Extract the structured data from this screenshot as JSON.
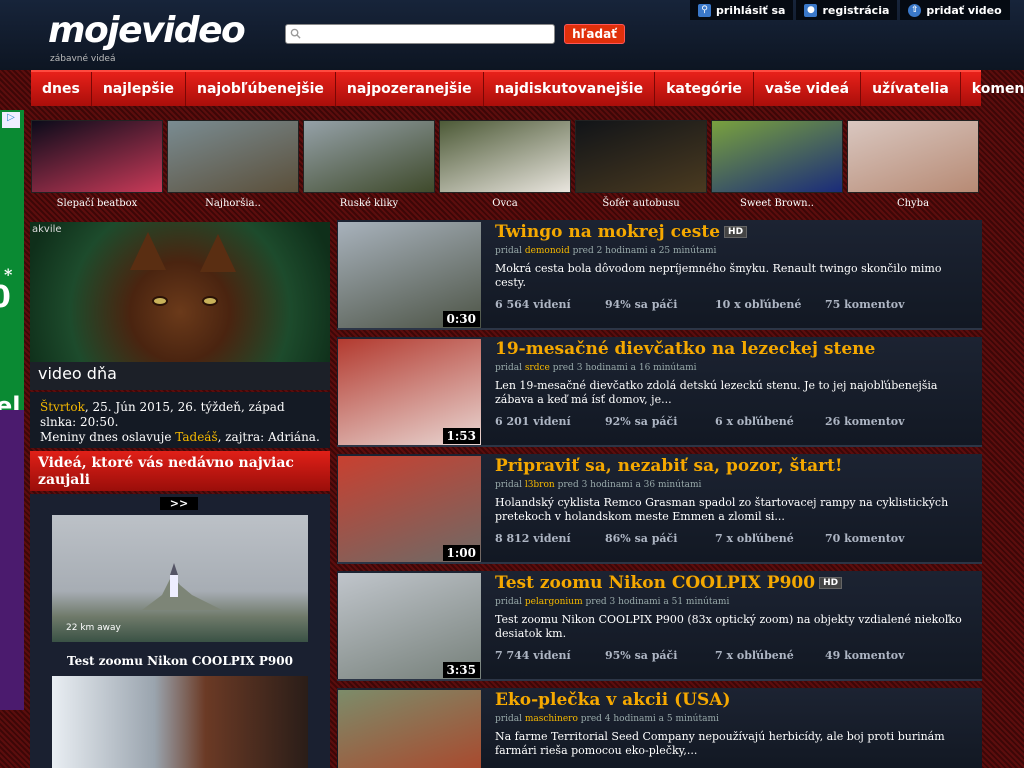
{
  "header": {
    "logo": "mojevideo",
    "logo_sub": "zábavné videá",
    "search_placeholder": "",
    "search_button": "hľadať",
    "top_links": [
      {
        "label": "prihlásiť sa",
        "icon": "search-icon"
      },
      {
        "label": "registrácia",
        "icon": "user-icon"
      },
      {
        "label": "pridať video",
        "icon": "upload-icon"
      }
    ]
  },
  "nav": [
    "dnes",
    "najlepšie",
    "najobľúbenejšie",
    "najpozeranejšie",
    "najdiskutovanejšie",
    "kategórie",
    "vaše videá",
    "užívatelia",
    "komentáre"
  ],
  "ad": {
    "star": "*",
    "big": "0",
    "big2": "el"
  },
  "strip": [
    {
      "label": "Slepačí beatbox",
      "c1": "#0b0b1a",
      "c2": "#c83a58"
    },
    {
      "label": "Najhoršia..",
      "c1": "#7a8c92",
      "c2": "#5b4f3a"
    },
    {
      "label": "Ruské kliky",
      "c1": "#95a1a8",
      "c2": "#3f4a2b"
    },
    {
      "label": "Ovca",
      "c1": "#4d5a37",
      "c2": "#e9e5de"
    },
    {
      "label": "Šofér autobusu",
      "c1": "#111418",
      "c2": "#4a3a20"
    },
    {
      "label": "Sweet Brown..",
      "c1": "#79a13e",
      "c2": "#1a2b7a"
    },
    {
      "label": "Chyba",
      "c1": "#d9c7c0",
      "c2": "#b78a74"
    }
  ],
  "video_dna": {
    "label": "video dňa",
    "tag": "akvile"
  },
  "day": {
    "day": "Štvrtok",
    "text": ", 25. Jún 2015, 26. týždeň, západ slnka: 20:50.",
    "name_prefix": "Meniny dnes oslavuje ",
    "name": "Tadeáš",
    "tomorrow": ", zajtra: Adriána."
  },
  "recent": {
    "title": "Videá, ktoré vás nedávno najviac zaujali",
    "nav": ">>",
    "km": "22 km away",
    "caption": "Test zoomu Nikon COOLPIX P900"
  },
  "videos": [
    {
      "title": "Twingo na mokrej ceste",
      "hd": "HD",
      "by_prefix": "pridal ",
      "user": "demonoid",
      "time": " pred 2 hodinami a 25 minútami",
      "desc": "Mokrá cesta bola dôvodom nepríjemného šmyku. Renault twingo skončilo mimo cesty.",
      "views": "6 564 videní",
      "likes": "94% sa páči",
      "favs": "10 x obľúbené",
      "comments": "75 komentov",
      "dur": "0:30",
      "c1": "#a8b2bc",
      "c2": "#4d5446"
    },
    {
      "title": "19-mesačné dievčatko na lezeckej stene",
      "hd": "",
      "by_prefix": "pridal ",
      "user": "srdce",
      "time": " pred 3 hodinami a 16 minútami",
      "desc": "Len 19-mesačné dievčatko zdolá detskú lezeckú stenu. Je to jej najobľúbenejšia zábava a keď má ísť domov, je...",
      "views": "6 201 videní",
      "likes": "92% sa páči",
      "favs": "6 x obľúbené",
      "comments": "26 komentov",
      "dur": "1:53",
      "c1": "#b33a2f",
      "c2": "#e9d6d2"
    },
    {
      "title": "Pripraviť sa, nezabiť sa, pozor, štart!",
      "hd": "",
      "by_prefix": "pridal ",
      "user": "l3bron",
      "time": " pred 3 hodinami a 36 minútami",
      "desc": "Holandský cyklista Remco Grasman spadol zo štartovacej rampy na cyklistických pretekoch v holandskom meste Emmen a zlomil si...",
      "views": "8 812 videní",
      "likes": "86% sa páči",
      "favs": "7 x obľúbené",
      "comments": "70 komentov",
      "dur": "1:00",
      "c1": "#c84030",
      "c2": "#6e6a66"
    },
    {
      "title": "Test zoomu Nikon COOLPIX P900",
      "hd": "HD",
      "by_prefix": "pridal ",
      "user": "pelargonium",
      "time": " pred 3 hodinami a 51 minútami",
      "desc": "Test zoomu Nikon COOLPIX P900 (83x optický zoom) na objekty vzdialené niekoľko desiatok km.",
      "views": "7 744 videní",
      "likes": "95% sa páči",
      "favs": "7 x obľúbené",
      "comments": "49 komentov",
      "dur": "3:35",
      "c1": "#c0c5cb",
      "c2": "#76807a"
    },
    {
      "title": "Eko-plečka v akcii (USA)",
      "hd": "",
      "by_prefix": "pridal ",
      "user": "maschinero",
      "time": " pred 4 hodinami a 5 minútami",
      "desc": "Na farme Territorial Seed Company nepoužívajú herbicídy, ale boj proti burinám farmári rieša pomocou eko-plečky,...",
      "views": "",
      "likes": "",
      "favs": "",
      "comments": "",
      "dur": "",
      "c1": "#7c8c6a",
      "c2": "#b23c22"
    }
  ]
}
